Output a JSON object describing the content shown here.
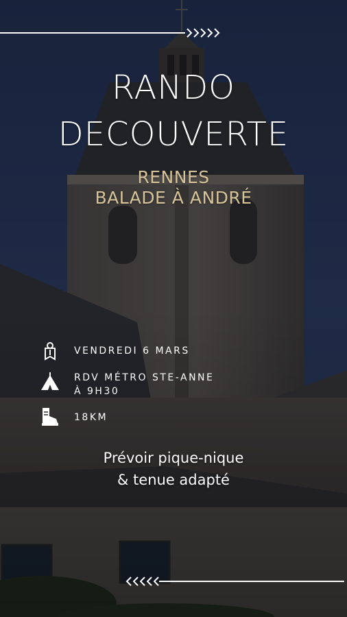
{
  "title": {
    "line1": "RANDO",
    "line2": "DECOUVERTE"
  },
  "subtitle": {
    "line1": "RENNES",
    "line2": "BALADE À ANDRÉ"
  },
  "info": {
    "date": "VENDREDI 6 MARS",
    "meeting_line1": "RDV  MÉTRO STE-ANNE",
    "meeting_line2": "À 9H30",
    "distance": "18KM"
  },
  "note": {
    "line1": "Prévoir pique-nique",
    "line2": "& tenue adapté"
  },
  "icons": {
    "date": "banner-emblem-icon",
    "meeting": "tent-icon",
    "distance": "hiking-boot-icon",
    "top_arrows": "chevrons-right-icon",
    "bottom_arrows": "chevrons-left-icon"
  },
  "colors": {
    "accent": "#d6c39a",
    "sky": "#22314f",
    "text": "#ffffff"
  }
}
